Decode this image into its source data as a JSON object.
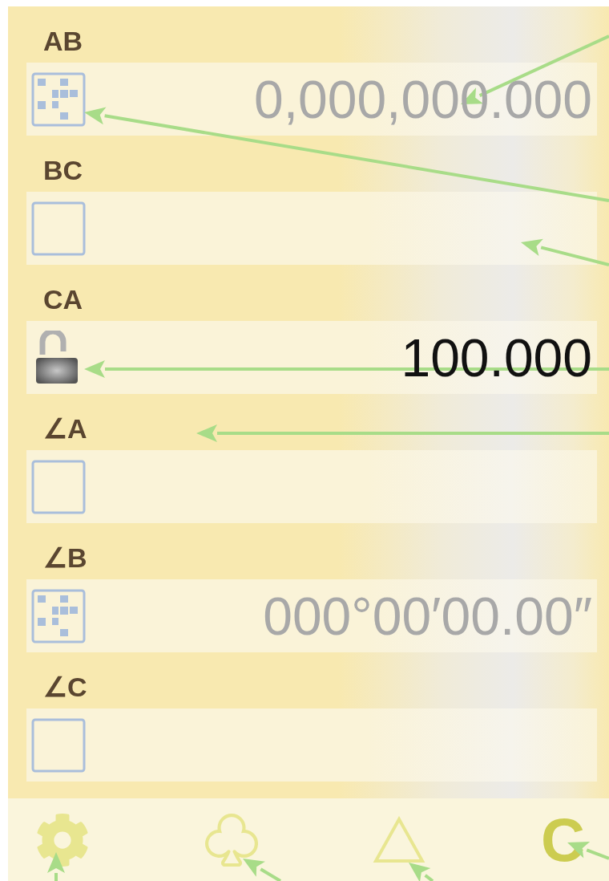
{
  "fields": [
    {
      "label": "AB",
      "kind": "keypad",
      "placeholder": "0,000,000.000"
    },
    {
      "label": "BC",
      "kind": "blank"
    },
    {
      "label": "CA",
      "kind": "unlocked",
      "value": "100.000"
    },
    {
      "label": "∠A",
      "kind": "blank"
    },
    {
      "label": "∠B",
      "kind": "keypad",
      "placeholder": "000°00′00.00″"
    },
    {
      "label": "∠C",
      "kind": "blank"
    }
  ],
  "toolbar": {
    "clear_label": "C"
  }
}
